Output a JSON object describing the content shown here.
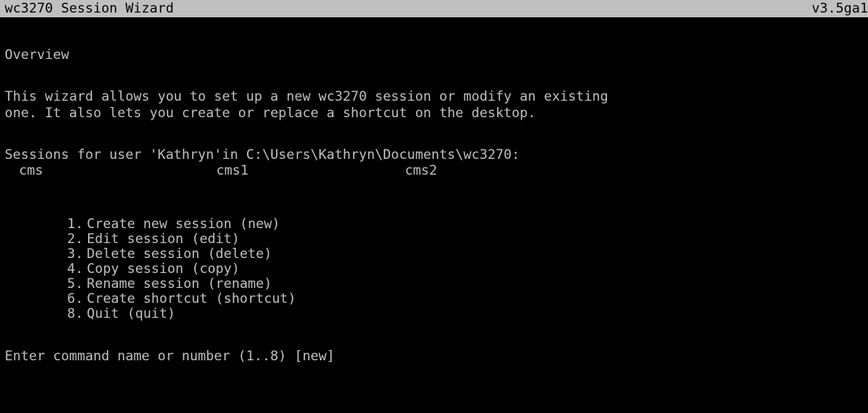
{
  "window": {
    "title": "wc3270 Session Wizard",
    "version": "v3.5ga1"
  },
  "overview": {
    "heading": "Overview",
    "line1": "This wizard allows you to set up a new wc3270 session or modify an existing",
    "line2": "one. It also lets you create or replace a shortcut on the desktop."
  },
  "sessions": {
    "header": "Sessions for user 'Kathryn'in C:\\Users\\Kathryn\\Documents\\wc3270:",
    "items": [
      "cms",
      "cms1",
      "cms2"
    ]
  },
  "menu": {
    "items": [
      {
        "number": "1.",
        "label": "Create new session (new)"
      },
      {
        "number": "2.",
        "label": "Edit session (edit)"
      },
      {
        "number": "3.",
        "label": "Delete session (delete)"
      },
      {
        "number": "4.",
        "label": "Copy session (copy)"
      },
      {
        "number": "5.",
        "label": "Rename session (rename)"
      },
      {
        "number": "6.",
        "label": "Create shortcut (shortcut)"
      },
      {
        "number": "8.",
        "label": "Quit (quit)"
      }
    ]
  },
  "prompt": {
    "text": "Enter command name or number (1..8) [new]"
  },
  "colors": {
    "background": "#000000",
    "foreground": "#c0c0c0",
    "titlebar": "#c0c0c0"
  }
}
